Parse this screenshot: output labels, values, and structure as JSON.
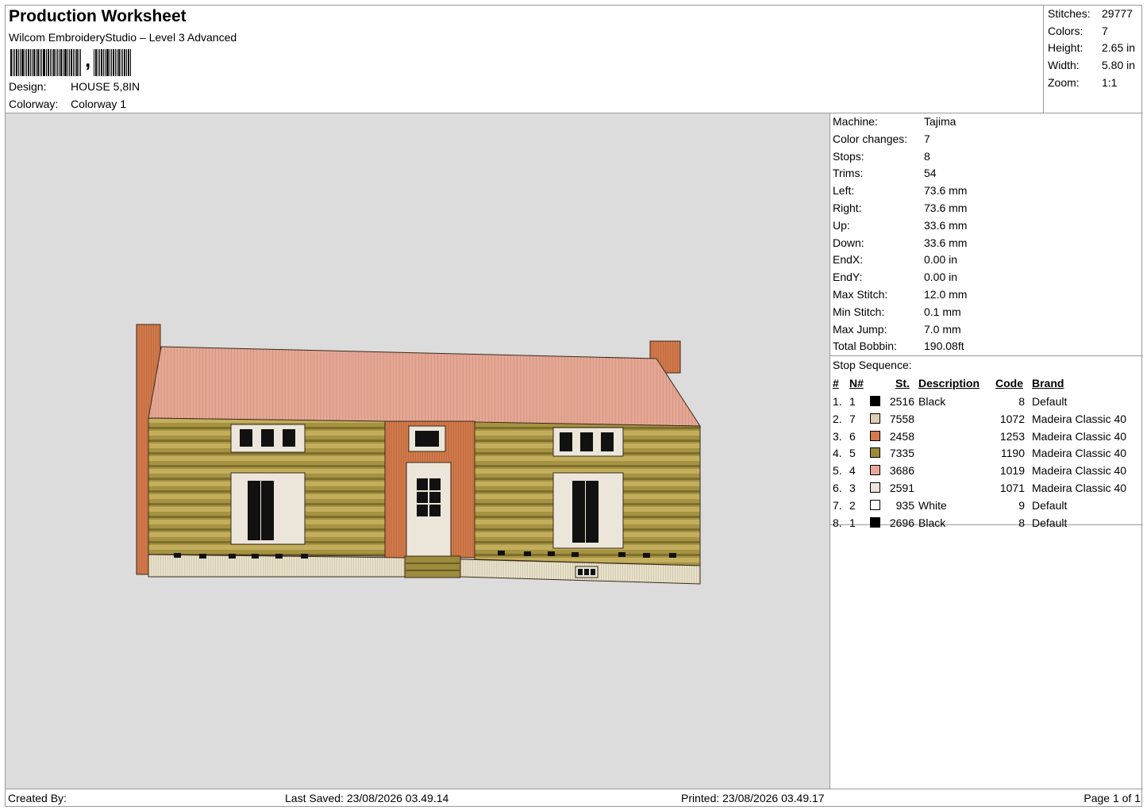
{
  "header": {
    "title": "Production Worksheet",
    "subtitle": "Wilcom EmbroideryStudio – Level 3 Advanced",
    "barcode_comma": ",",
    "design_label": "Design:",
    "design_value": "HOUSE 5,8IN",
    "colorway_label": "Colorway:",
    "colorway_value": "Colorway 1"
  },
  "summary": [
    {
      "label": "Stitches:",
      "value": "29777"
    },
    {
      "label": "Colors:",
      "value": "7"
    },
    {
      "label": "Height:",
      "value": "2.65 in"
    },
    {
      "label": "Width:",
      "value": "5.80 in"
    },
    {
      "label": "Zoom:",
      "value": "1:1"
    }
  ],
  "machine": [
    {
      "label": "Machine:",
      "value": "Tajima"
    },
    {
      "label": "Color changes:",
      "value": "7"
    },
    {
      "label": "Stops:",
      "value": "8"
    },
    {
      "label": "Trims:",
      "value": "54"
    },
    {
      "label": "Left:",
      "value": "73.6 mm"
    },
    {
      "label": "Right:",
      "value": "73.6 mm"
    },
    {
      "label": "Up:",
      "value": "33.6 mm"
    },
    {
      "label": "Down:",
      "value": "33.6 mm"
    },
    {
      "label": "EndX:",
      "value": "0.00 in"
    },
    {
      "label": "EndY:",
      "value": "0.00 in"
    },
    {
      "label": "Max Stitch:",
      "value": "12.0 mm"
    },
    {
      "label": "Min Stitch:",
      "value": "0.1 mm"
    },
    {
      "label": "Max Jump:",
      "value": "7.0 mm"
    },
    {
      "label": "Total Bobbin:",
      "value": "190.08ft"
    }
  ],
  "stop_sequence": {
    "title": "Stop Sequence:",
    "columns": {
      "num": "#",
      "n": "N#",
      "st": "St.",
      "description": "Description",
      "code": "Code",
      "brand": "Brand"
    },
    "rows": [
      {
        "num": "1.",
        "n": "1",
        "color": "#000000",
        "st": "2516",
        "description": "Black",
        "code": "8",
        "brand": "Default"
      },
      {
        "num": "2.",
        "n": "7",
        "color": "#dccdb4",
        "st": "7558",
        "description": "",
        "code": "1072",
        "brand": "Madeira Classic 40"
      },
      {
        "num": "3.",
        "n": "6",
        "color": "#d57a4c",
        "st": "2458",
        "description": "",
        "code": "1253",
        "brand": "Madeira Classic 40"
      },
      {
        "num": "4.",
        "n": "5",
        "color": "#9c8a3d",
        "st": "7335",
        "description": "",
        "code": "1190",
        "brand": "Madeira Classic 40"
      },
      {
        "num": "5.",
        "n": "4",
        "color": "#e8a79a",
        "st": "3686",
        "description": "",
        "code": "1019",
        "brand": "Madeira Classic 40"
      },
      {
        "num": "6.",
        "n": "3",
        "color": "#ebe6d9",
        "st": "2591",
        "description": "",
        "code": "1071",
        "brand": "Madeira Classic 40"
      },
      {
        "num": "7.",
        "n": "2",
        "color": "#ffffff",
        "st": "935",
        "description": "White",
        "code": "9",
        "brand": "Default"
      },
      {
        "num": "8.",
        "n": "1",
        "color": "#000000",
        "st": "2696",
        "description": "Black",
        "code": "8",
        "brand": "Default"
      }
    ]
  },
  "footer": {
    "created_by": "Created By:",
    "last_saved": "Last Saved: 23/08/2026 03.49.14",
    "printed": "Printed: 23/08/2026 03.49.17",
    "page": "Page 1 of 1"
  },
  "colors": {
    "canvas_bg": "#dcdcdc",
    "roof": "#e3a895",
    "logs": "#9c8a3d",
    "brick": "#d07a4c",
    "trim": "#ebe6d9",
    "window_pane": "#111111"
  }
}
